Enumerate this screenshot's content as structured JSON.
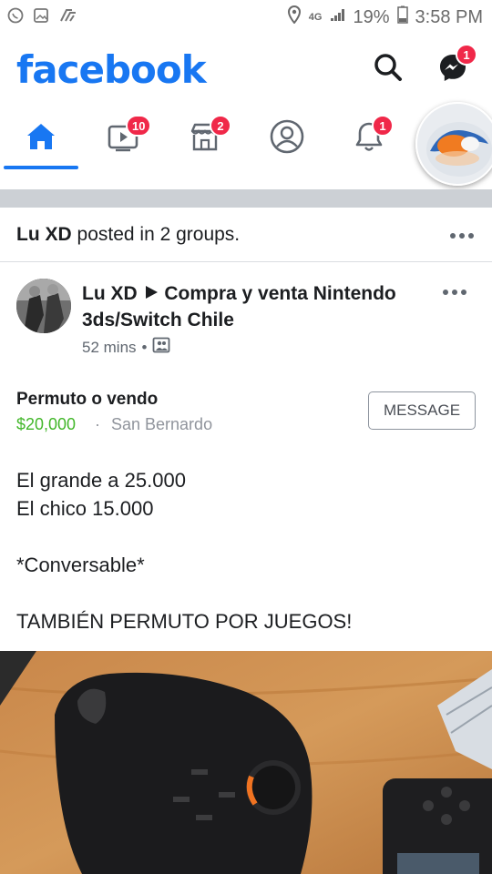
{
  "status_bar": {
    "battery": "19%",
    "time": "3:58 PM",
    "network": "4G"
  },
  "header": {
    "logo": "facebook",
    "messenger_badge": "1",
    "brand_color": "#1877f2"
  },
  "nav": {
    "items": [
      {
        "icon": "home-icon",
        "badge": ""
      },
      {
        "icon": "watch-icon",
        "badge": "10"
      },
      {
        "icon": "marketplace-icon",
        "badge": "2"
      },
      {
        "icon": "profile-icon",
        "badge": ""
      },
      {
        "icon": "bell-icon",
        "badge": "1"
      }
    ]
  },
  "post": {
    "header": {
      "author": "Lu XD",
      "text": "posted in 2 groups."
    },
    "author": "Lu XD",
    "group": "Compra y venta Nintendo 3ds/Switch Chile",
    "time": "52 mins",
    "sale": {
      "title": "Permuto o vendo",
      "price": "$20,000",
      "separator": "·",
      "location": "San Bernardo",
      "button": "MESSAGE"
    },
    "body": [
      "El grande a 25.000",
      "El chico 15.000",
      "",
      "*Conversable*",
      "",
      "TAMBIÉN PERMUTO POR JUEGOS!"
    ]
  }
}
